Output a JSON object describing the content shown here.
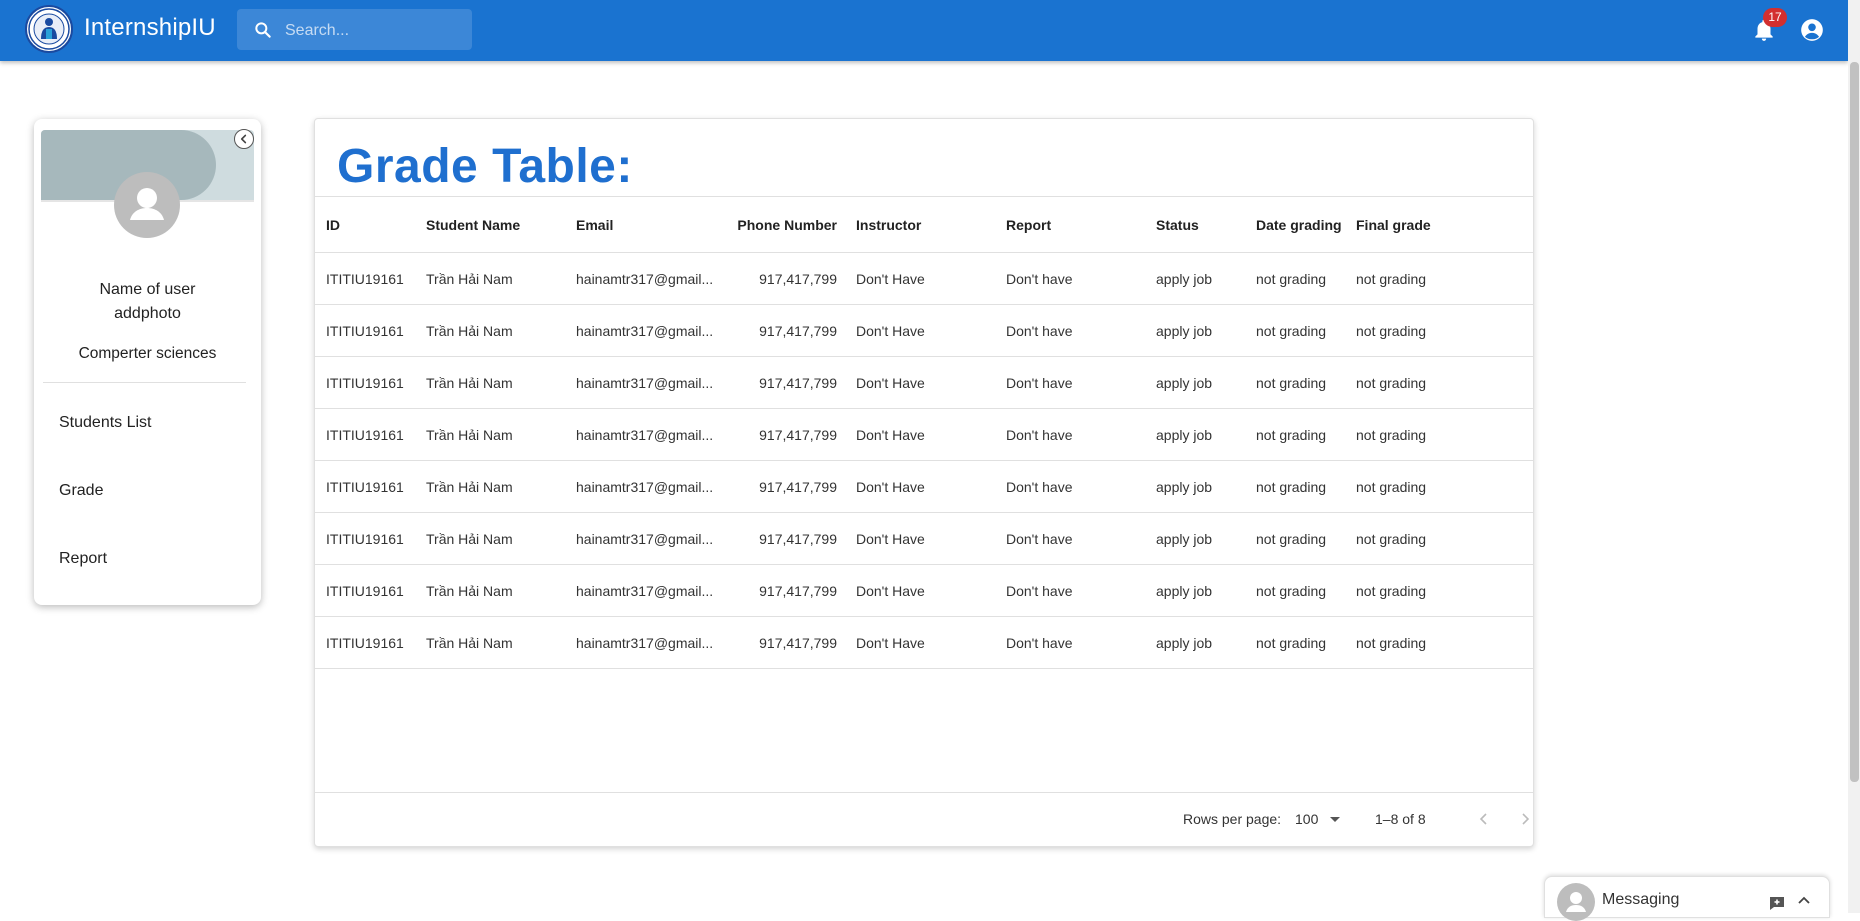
{
  "app": {
    "title": "InternshipIU",
    "search_placeholder": "Search...",
    "notification_count": "17",
    "brand_color": "#1a73d0"
  },
  "sidebar": {
    "user_name": "Name of user",
    "photo_label": "addphoto",
    "department": "Comperter sciences",
    "items": [
      {
        "label": "Students List"
      },
      {
        "label": "Grade"
      },
      {
        "label": "Report"
      }
    ]
  },
  "table": {
    "title": "Grade Table:",
    "columns": [
      "ID",
      "Student Name",
      "Email",
      "Phone Number",
      "Instructor",
      "Report",
      "Status",
      "Date grading",
      "Final grade"
    ],
    "rows": [
      [
        "ITITIU19161",
        "Trần Hải Nam",
        "hainamtr317@gmail...",
        "917,417,799",
        "Don't Have",
        "Don't have",
        "apply job",
        "not grading",
        "not grading"
      ],
      [
        "ITITIU19161",
        "Trần Hải Nam",
        "hainamtr317@gmail...",
        "917,417,799",
        "Don't Have",
        "Don't have",
        "apply job",
        "not grading",
        "not grading"
      ],
      [
        "ITITIU19161",
        "Trần Hải Nam",
        "hainamtr317@gmail...",
        "917,417,799",
        "Don't Have",
        "Don't have",
        "apply job",
        "not grading",
        "not grading"
      ],
      [
        "ITITIU19161",
        "Trần Hải Nam",
        "hainamtr317@gmail...",
        "917,417,799",
        "Don't Have",
        "Don't have",
        "apply job",
        "not grading",
        "not grading"
      ],
      [
        "ITITIU19161",
        "Trần Hải Nam",
        "hainamtr317@gmail...",
        "917,417,799",
        "Don't Have",
        "Don't have",
        "apply job",
        "not grading",
        "not grading"
      ],
      [
        "ITITIU19161",
        "Trần Hải Nam",
        "hainamtr317@gmail...",
        "917,417,799",
        "Don't Have",
        "Don't have",
        "apply job",
        "not grading",
        "not grading"
      ],
      [
        "ITITIU19161",
        "Trần Hải Nam",
        "hainamtr317@gmail...",
        "917,417,799",
        "Don't Have",
        "Don't have",
        "apply job",
        "not grading",
        "not grading"
      ],
      [
        "ITITIU19161",
        "Trần Hải Nam",
        "hainamtr317@gmail...",
        "917,417,799",
        "Don't Have",
        "Don't have",
        "apply job",
        "not grading",
        "not grading"
      ]
    ],
    "footer": {
      "rows_per_page_label": "Rows per page:",
      "rows_per_page_value": "100",
      "pagination_info": "1–8 of 8"
    }
  },
  "messaging": {
    "label": "Messaging"
  },
  "icons": {
    "search": "search-icon",
    "notifications": "bell-icon",
    "account": "account-circle-icon",
    "collapse": "chevron-left-icon",
    "prev_page": "chevron-left-icon",
    "next_page": "chevron-right-icon",
    "new_message": "new-message-icon",
    "expand": "chevron-up-icon"
  }
}
